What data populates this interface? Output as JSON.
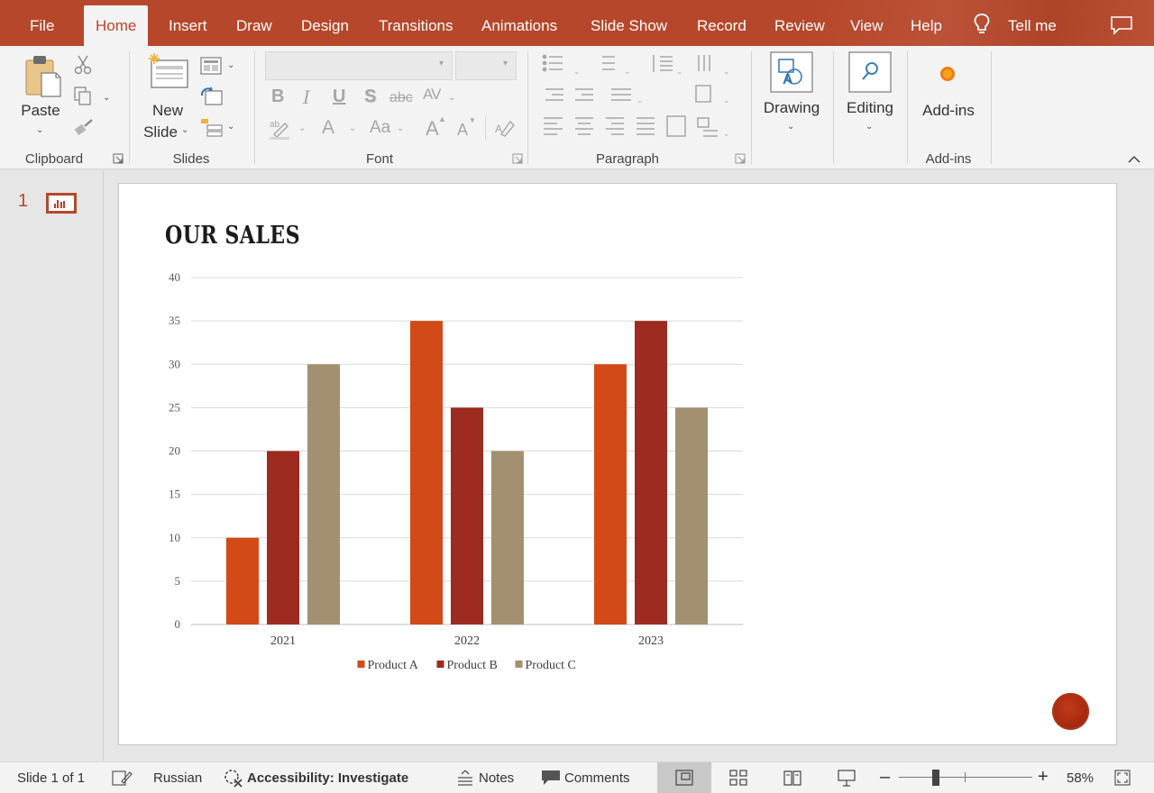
{
  "menu": {
    "file": "File",
    "tabs": [
      "Home",
      "Insert",
      "Draw",
      "Design",
      "Transitions",
      "Animations",
      "Slide Show",
      "Record",
      "Review",
      "View",
      "Help"
    ],
    "active_tab": "Home",
    "tell_me": "Tell me"
  },
  "ribbon": {
    "clipboard": {
      "paste": "Paste",
      "group": "Clipboard"
    },
    "slides": {
      "new_slide_line1": "New",
      "new_slide_line2": "Slide",
      "group": "Slides"
    },
    "font": {
      "group": "Font",
      "bold": "B",
      "italic": "I",
      "underline": "U",
      "shadow": "S",
      "strike": "abc",
      "spacing": "AV",
      "font_color": "A",
      "case": "Aa",
      "grow": "A",
      "shrink": "A"
    },
    "paragraph": {
      "group": "Paragraph"
    },
    "drawing": {
      "label": "Drawing"
    },
    "editing": {
      "label": "Editing"
    },
    "addins": {
      "label": "Add-ins",
      "group": "Add-ins"
    }
  },
  "slides_pane": {
    "slide_number": "1"
  },
  "slide": {
    "title": "OUR SALES"
  },
  "chart_data": {
    "type": "bar",
    "title": "",
    "categories": [
      "2021",
      "2022",
      "2023"
    ],
    "series": [
      {
        "name": "Product A",
        "values": [
          10,
          35,
          30
        ],
        "color": "#d24a17"
      },
      {
        "name": "Product B",
        "values": [
          20,
          25,
          35
        ],
        "color": "#9d2b1f"
      },
      {
        "name": "Product C",
        "values": [
          30,
          20,
          25
        ],
        "color": "#a39070"
      }
    ],
    "yticks": [
      "0",
      "5",
      "10",
      "15",
      "20",
      "25",
      "30",
      "35",
      "40"
    ],
    "ylim": [
      0,
      40
    ],
    "grid": true,
    "legend": "bottom"
  },
  "status": {
    "slide_info": "Slide 1 of 1",
    "language": "Russian",
    "accessibility": "Accessibility: Investigate",
    "notes": "Notes",
    "comments": "Comments",
    "zoom": "58%"
  },
  "colors": {
    "accent": "#b7472a",
    "ribbon_bg": "#f3f3f3"
  }
}
